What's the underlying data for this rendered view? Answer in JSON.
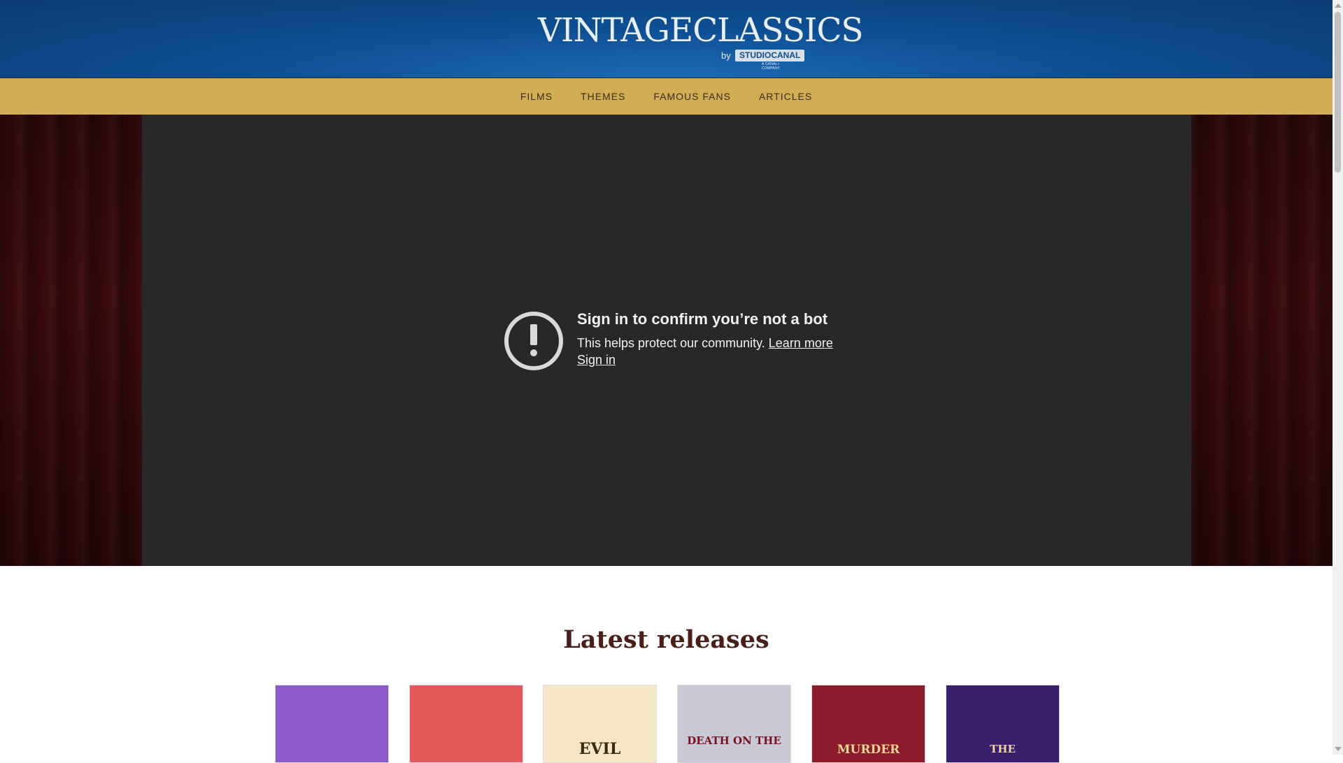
{
  "header": {
    "logo_main": "VINTAGECLASSICS",
    "logo_by": "by",
    "logo_studio": "STUDIOCANAL",
    "logo_sub": "A CANAL+ COMPANY"
  },
  "nav": {
    "items": [
      "FILMS",
      "THEMES",
      "FAMOUS FANS",
      "ARTICLES"
    ]
  },
  "video": {
    "title": "Sign in to confirm you’re not a bot",
    "text": "This helps protect our community. ",
    "learn_more": "Learn more",
    "sign_in": "Sign in"
  },
  "latest": {
    "title": "Latest releases",
    "posters": [
      {
        "label": "",
        "bg": "#8a5bc7"
      },
      {
        "label": "",
        "bg": "#e05a5a"
      },
      {
        "label": "EVIL",
        "bg": "#f5e6c8"
      },
      {
        "label": "DEATH ON THE",
        "bg": "#c9c9d6"
      },
      {
        "label": "MURDER",
        "bg": "#8b1a2b"
      },
      {
        "label": "THE",
        "bg": "#3a1f6e"
      }
    ]
  },
  "colors": {
    "header_blue": "#0e4f93",
    "nav_gold": "#d1ae55",
    "video_bg": "#282828",
    "title_maroon": "#4a1f1a"
  }
}
